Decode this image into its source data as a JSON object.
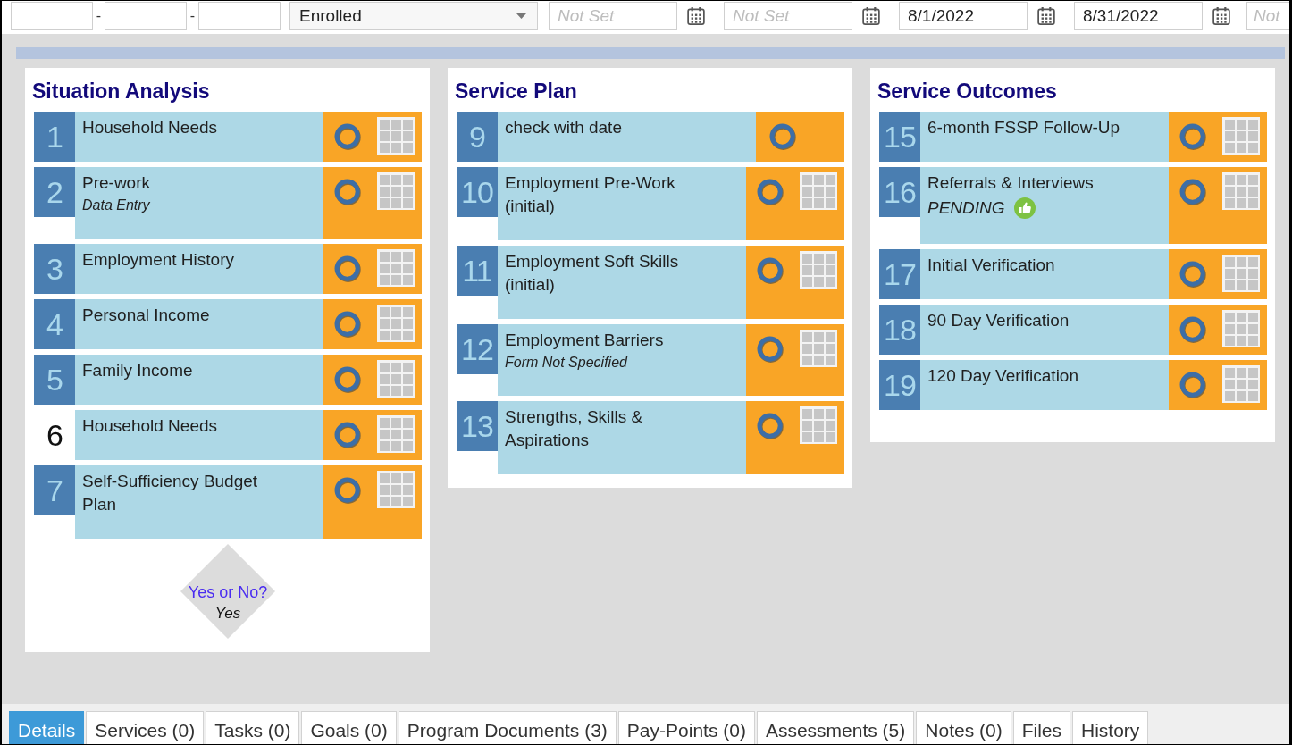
{
  "filter_bar": {
    "id_separators": [
      "-",
      "-"
    ],
    "status_select": {
      "value": "Enrolled"
    },
    "date_fields": [
      {
        "placeholder": "Not Set",
        "calendar": true
      },
      {
        "placeholder": "Not Set",
        "calendar": true
      },
      {
        "value": "8/1/2022",
        "calendar": true
      },
      {
        "value": "8/31/2022",
        "calendar": true
      },
      {
        "placeholder": "Not",
        "calendar": false
      }
    ]
  },
  "sections": [
    {
      "title": "Situation Analysis",
      "steps": [
        {
          "number": "1",
          "label": "Household Needs",
          "number_box": true,
          "form_grid": true
        },
        {
          "number": "2",
          "label": "Pre-work",
          "note": "Data Entry",
          "number_box": true,
          "form_grid": true
        },
        {
          "number": "3",
          "label": "Employment History",
          "number_box": true,
          "form_grid": true
        },
        {
          "number": "4",
          "label": "Personal Income",
          "number_box": true,
          "form_grid": true
        },
        {
          "number": "5",
          "label": "Family Income",
          "number_box": true,
          "form_grid": true
        },
        {
          "number": "6",
          "label": "Household Needs",
          "number_box": false,
          "form_grid": true
        },
        {
          "number": "7",
          "label": "Self-Sufficiency Budget Plan",
          "number_box": true,
          "form_grid": true
        }
      ],
      "decision": {
        "question": "Yes or No?",
        "answer": "Yes"
      }
    },
    {
      "title": "Service Plan",
      "steps": [
        {
          "number": "9",
          "label": "check with date",
          "number_box": true,
          "form_grid": false
        },
        {
          "number": "10",
          "label": "Employment Pre-Work (initial)",
          "number_box": true,
          "form_grid": true
        },
        {
          "number": "11",
          "label": "Employment Soft Skills (initial)",
          "number_box": true,
          "form_grid": true
        },
        {
          "number": "12",
          "label": "Employment Barriers",
          "note": "Form Not Specified",
          "number_box": true,
          "form_grid": true
        },
        {
          "number": "13",
          "label": "Strengths, Skills & Aspirations",
          "number_box": true,
          "form_grid": true
        }
      ]
    },
    {
      "title": "Service Outcomes",
      "steps": [
        {
          "number": "15",
          "label": "6-month FSSP Follow-Up",
          "number_box": true,
          "form_grid": true
        },
        {
          "number": "16",
          "label": "Referrals & Interviews",
          "status": {
            "text": "PENDING",
            "icon": true
          },
          "number_box": true,
          "form_grid": true
        },
        {
          "number": "17",
          "label": "Initial Verification",
          "number_box": true,
          "form_grid": true
        },
        {
          "number": "18",
          "label": "90 Day Verification",
          "number_box": true,
          "form_grid": true
        },
        {
          "number": "19",
          "label": "120 Day Verification",
          "number_box": true,
          "form_grid": true
        }
      ]
    }
  ],
  "tabs": [
    {
      "label": "Details",
      "selected": true
    },
    {
      "label": "Services (0)",
      "selected": false
    },
    {
      "label": "Tasks (0)",
      "selected": false
    },
    {
      "label": "Goals (0)",
      "selected": false
    },
    {
      "label": "Program Documents (3)",
      "selected": false
    },
    {
      "label": "Pay-Points (0)",
      "selected": false
    },
    {
      "label": "Assessments (5)",
      "selected": false
    },
    {
      "label": "Notes (0)",
      "selected": false
    },
    {
      "label": "Files",
      "selected": false
    },
    {
      "label": "History",
      "selected": false
    }
  ]
}
